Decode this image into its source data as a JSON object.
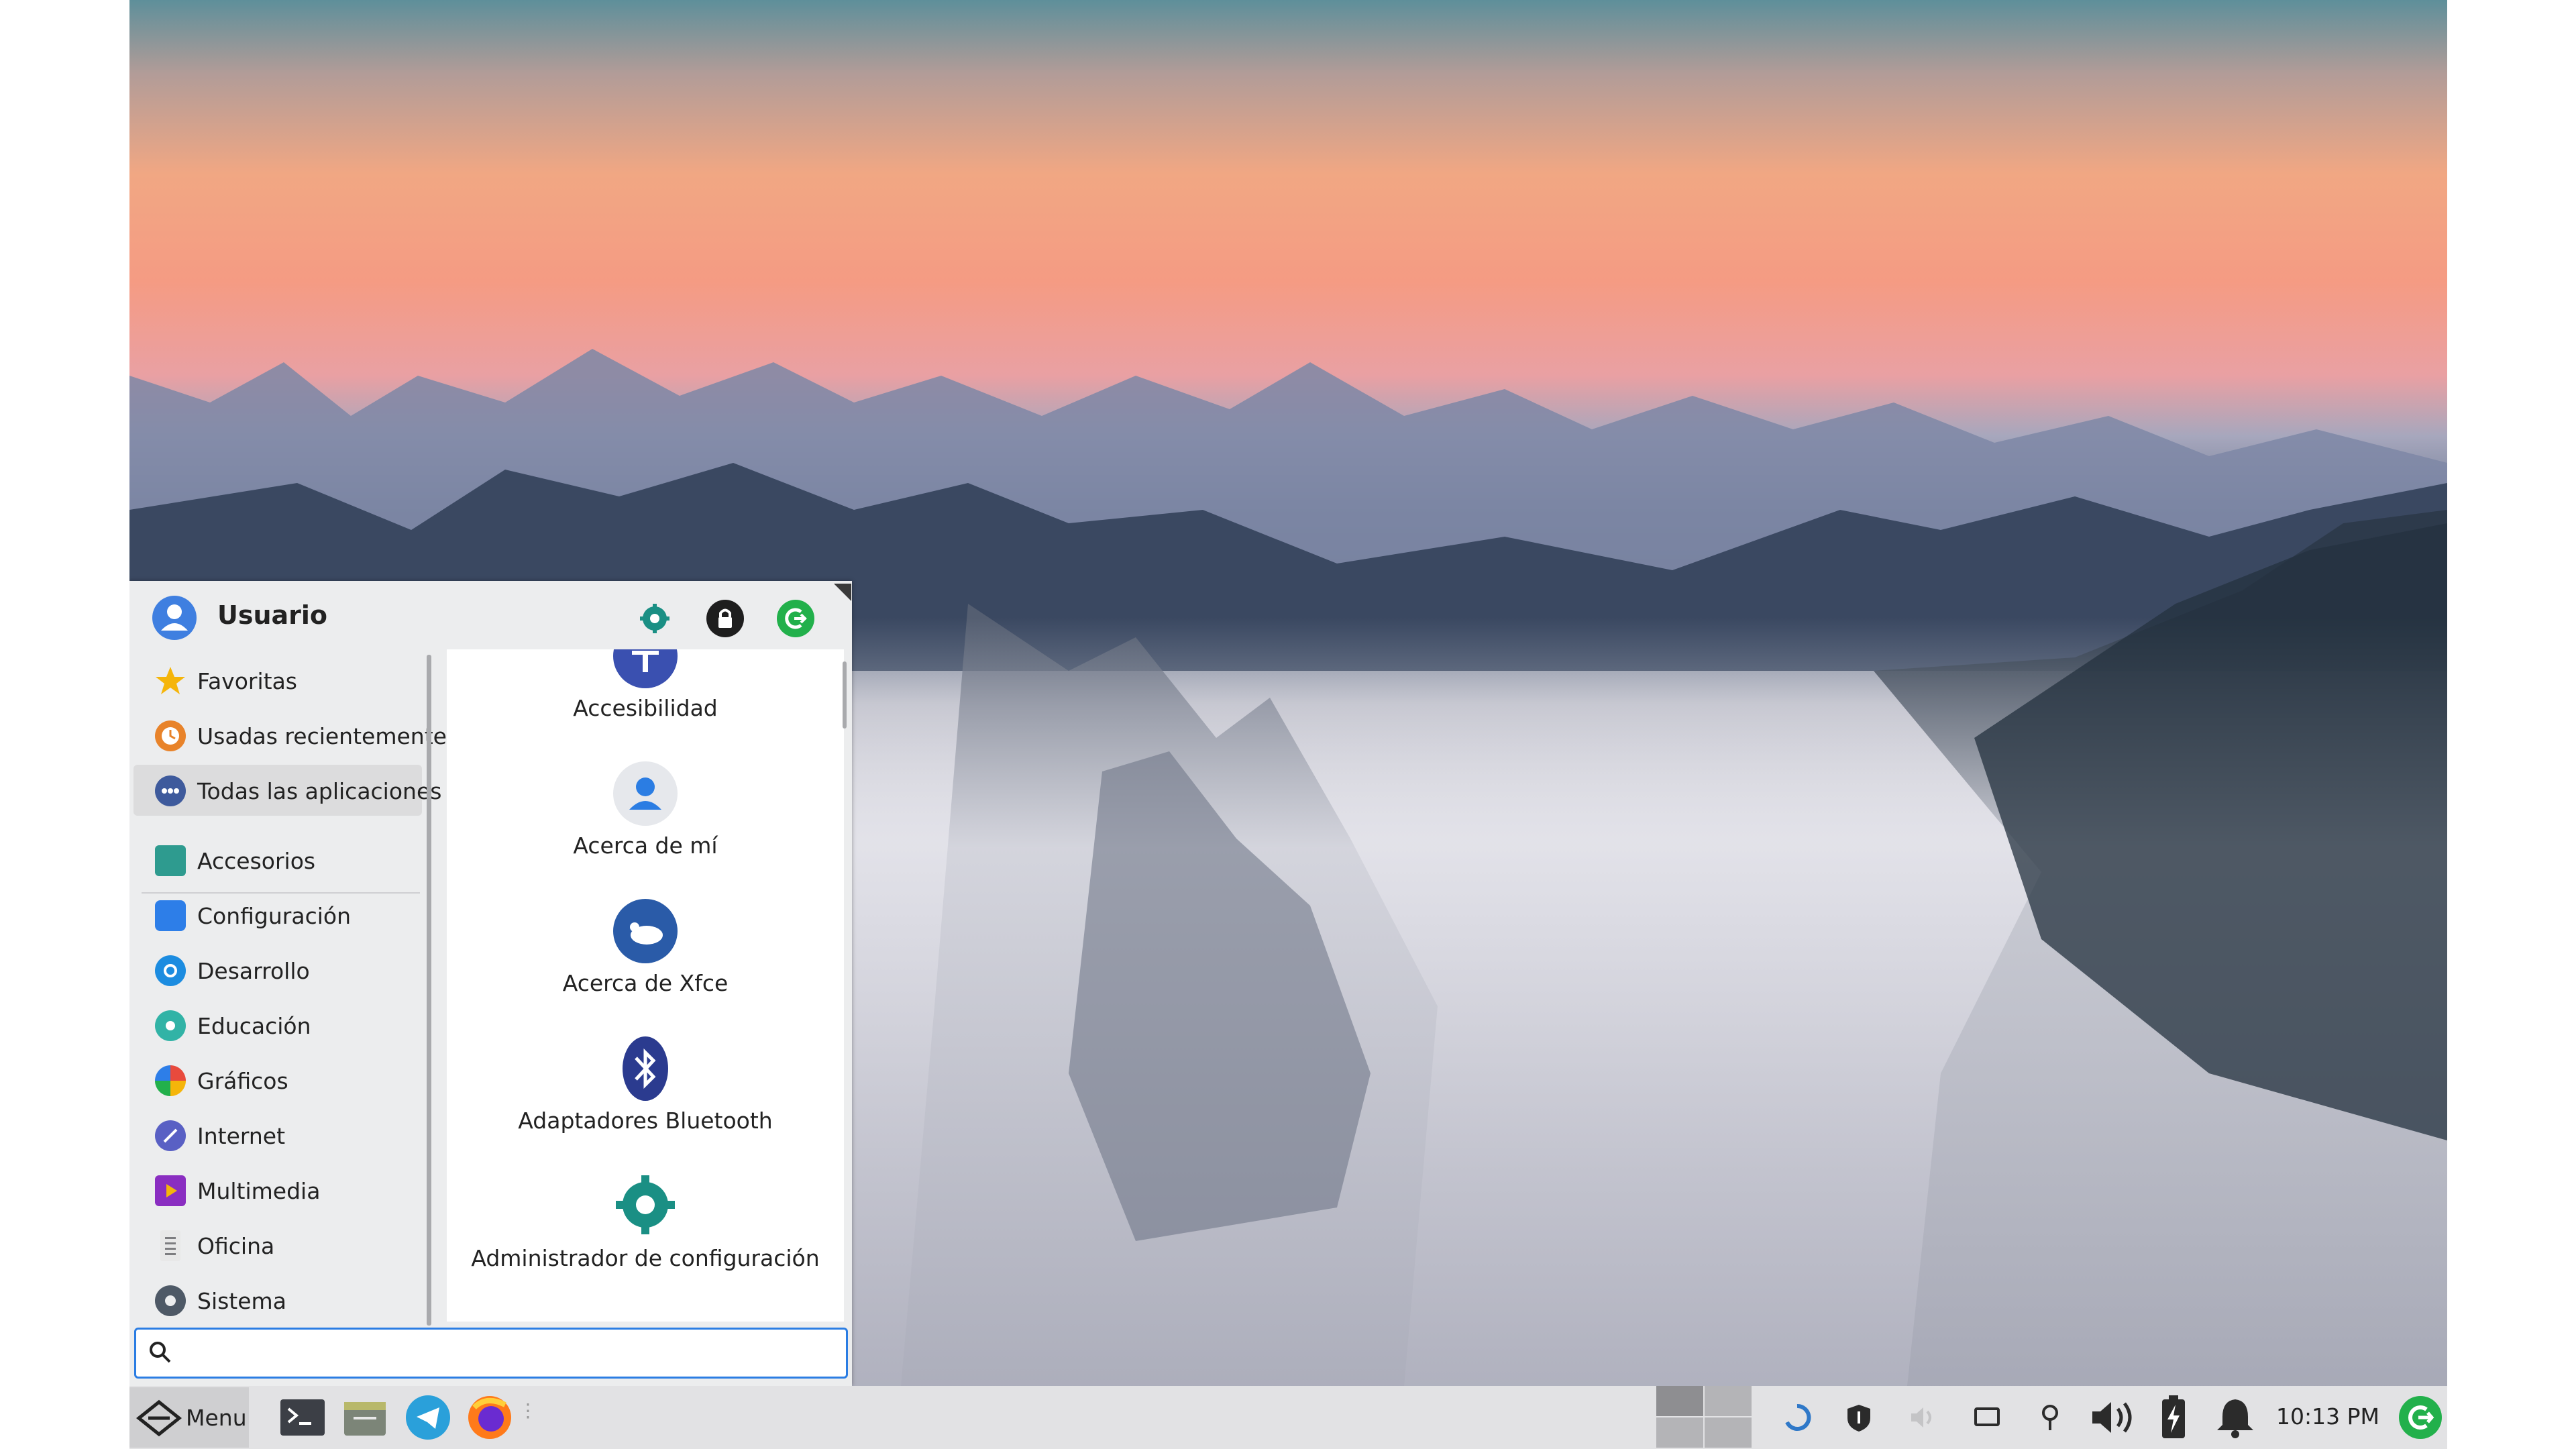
{
  "menu": {
    "username": "Usuario",
    "categories": [
      {
        "label": "Favoritas",
        "icon": "star-icon",
        "color": "#f5b50a"
      },
      {
        "label": "Usadas recientemente",
        "icon": "recent-clock-icon",
        "color": "#e8832a"
      },
      {
        "label": "Todas las aplicaciones",
        "icon": "all-apps-icon",
        "color": "#3e5a9c",
        "active": true
      },
      {
        "label": "Accesorios",
        "icon": "accessories-icon",
        "color": "#2e9b8f"
      },
      {
        "label": "Configuración",
        "icon": "settings-icon",
        "color": "#2d7ee8"
      },
      {
        "label": "Desarrollo",
        "icon": "development-icon",
        "color": "#1c8ce0"
      },
      {
        "label": "Educación",
        "icon": "education-icon",
        "color": "#31b3a6"
      },
      {
        "label": "Gráficos",
        "icon": "graphics-icon",
        "color": "#e84a3d"
      },
      {
        "label": "Internet",
        "icon": "internet-icon",
        "color": "#5960c4"
      },
      {
        "label": "Multimedia",
        "icon": "multimedia-icon",
        "color": "#8a2ec1"
      },
      {
        "label": "Oficina",
        "icon": "office-icon",
        "color": "#7d7d80"
      },
      {
        "label": "Sistema",
        "icon": "system-gear-icon",
        "color": "#4e5966"
      }
    ],
    "apps": [
      {
        "label": "Accesibilidad",
        "icon": "accessibility-icon"
      },
      {
        "label": "Acerca de mí",
        "icon": "about-me-icon"
      },
      {
        "label": "Acerca de Xfce",
        "icon": "xfce-mouse-icon"
      },
      {
        "label": "Adaptadores Bluetooth",
        "icon": "bluetooth-icon"
      },
      {
        "label": "Administrador de configuración",
        "icon": "config-manager-icon"
      }
    ],
    "search_placeholder": ""
  },
  "taskbar": {
    "menu_label": "Menu",
    "clock": "10:13 PM"
  },
  "colors": {
    "accent": "#2b7de3",
    "green": "#22b04b",
    "teal": "#1a8f84"
  }
}
